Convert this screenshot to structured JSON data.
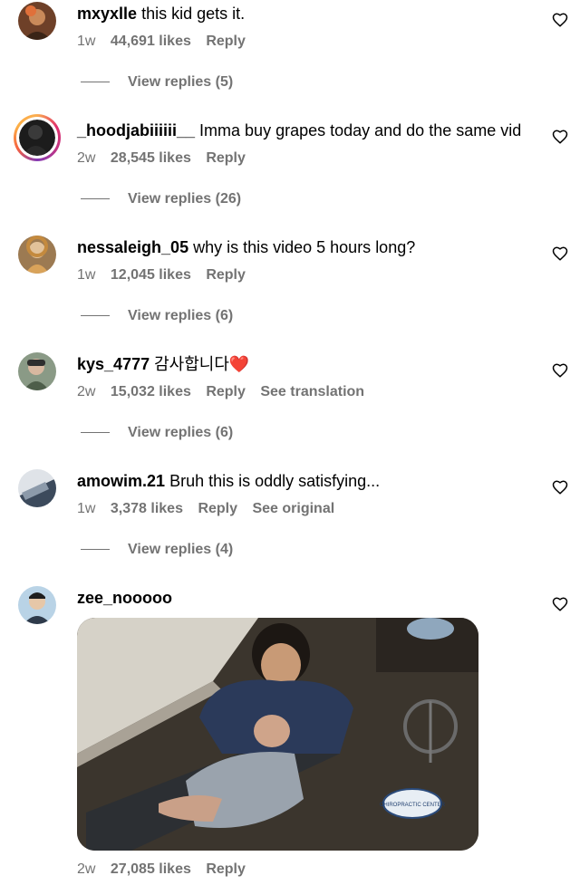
{
  "comments": [
    {
      "username": "mxyxlle",
      "text": "this kid gets it.",
      "time": "1w",
      "likes": "44,691 likes",
      "reply": "Reply",
      "extra": "",
      "replies": "View replies (5)",
      "avatar_color": "#7a4a2a"
    },
    {
      "username": "_hoodjabiiiiii__",
      "text": "Imma buy grapes today and do the same vid",
      "time": "2w",
      "likes": "28,545 likes",
      "reply": "Reply",
      "extra": "",
      "replies": "View replies (26)",
      "avatar_color": "#2b2b2b"
    },
    {
      "username": "nessaleigh_05",
      "text": "why is this video 5 hours long?",
      "time": "1w",
      "likes": "12,045 likes",
      "reply": "Reply",
      "extra": "",
      "replies": "View replies (6)",
      "avatar_color": "#b08a5a"
    },
    {
      "username": "kys_4777",
      "text": "감사합니다❤️",
      "time": "2w",
      "likes": "15,032 likes",
      "reply": "Reply",
      "extra": "See translation",
      "replies": "View replies (6)",
      "avatar_color": "#6b7d6a"
    },
    {
      "username": "amowim.21",
      "text": "Bruh this is oddly satisfying...",
      "time": "1w",
      "likes": "3,378 likes",
      "reply": "Reply",
      "extra": "See original",
      "replies": "View replies (4)",
      "avatar_color": "#4a5a6e"
    },
    {
      "username": "zee_nooooo",
      "text": "",
      "time": "2w",
      "likes": "27,085 likes",
      "reply": "Reply",
      "extra": "",
      "replies": "",
      "avatar_color": "#5a6a7a"
    }
  ],
  "media": {
    "overlay_text": "CHIROPRACTIC CENTER"
  },
  "icons": {
    "like": "heart-outline-icon"
  }
}
